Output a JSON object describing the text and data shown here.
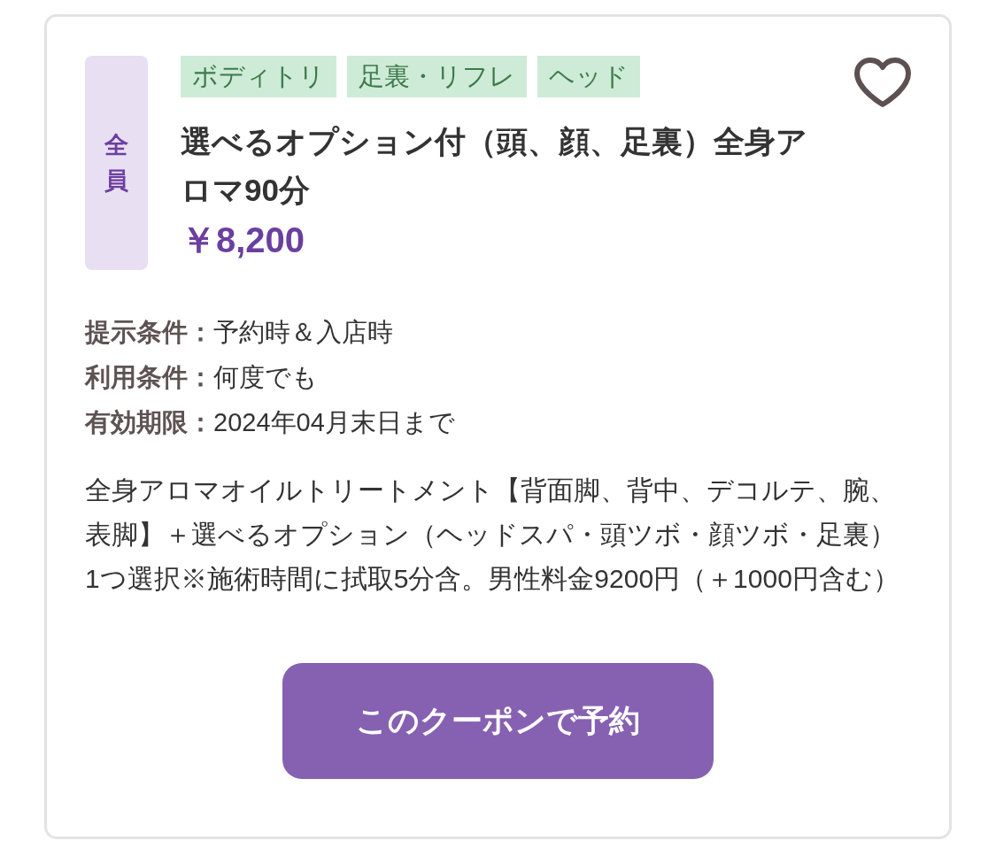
{
  "card": {
    "audience_badge": "全員",
    "tags": [
      {
        "label": "ボディトリ"
      },
      {
        "label": "足裏・リフレ"
      },
      {
        "label": "ヘッド"
      }
    ],
    "favorite": {
      "on": false
    },
    "title": "選べるオプション付（頭、顔、足裏）全身アロマ90分",
    "price": "￥8,200",
    "conditions": [
      {
        "label": "提示条件：",
        "value": "予約時＆入店時"
      },
      {
        "label": "利用条件：",
        "value": "何度でも"
      },
      {
        "label": "有効期限：",
        "value": "2024年04月末日まで"
      }
    ],
    "description": "全身アロマオイルトリートメント【背面脚、背中、デコルテ、腕、表脚】＋選べるオプション（ヘッドスパ・頭ツボ・顔ツボ・足裏）1つ選択※施術時間に拭取5分含。男性料金9200円（＋1000円含む）",
    "reserve_button": "このクーポンで予約"
  }
}
